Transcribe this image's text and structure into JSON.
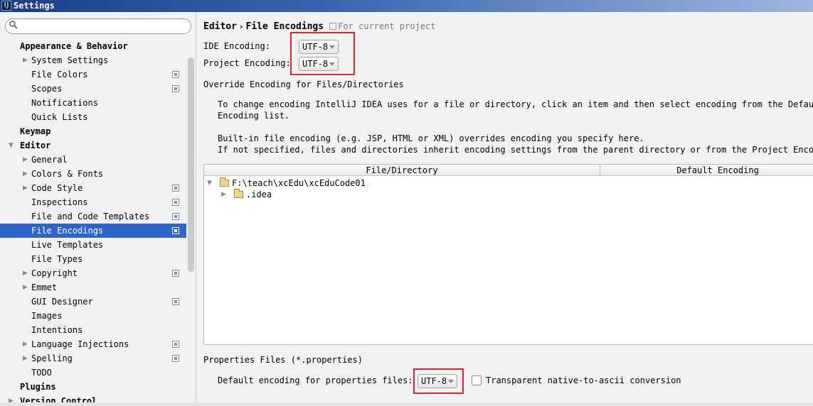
{
  "window": {
    "title": "Settings",
    "icon": "intellij-app-icon"
  },
  "sidebar": {
    "search": {
      "value": "",
      "placeholder": ""
    },
    "items": [
      {
        "label": "Appearance & Behavior",
        "level": 0,
        "bold": true,
        "arrow": ""
      },
      {
        "label": "System Settings",
        "level": 1,
        "arrow": "right"
      },
      {
        "label": "File Colors",
        "level": 1,
        "arrow": "",
        "project_icon": true
      },
      {
        "label": "Scopes",
        "level": 1,
        "arrow": "",
        "project_icon": true
      },
      {
        "label": "Notifications",
        "level": 1,
        "arrow": ""
      },
      {
        "label": "Quick Lists",
        "level": 1,
        "arrow": ""
      },
      {
        "label": "Keymap",
        "level": 0,
        "bold": true,
        "arrow": ""
      },
      {
        "label": "Editor",
        "level": 0,
        "bold": true,
        "arrow": "down"
      },
      {
        "label": "General",
        "level": 1,
        "arrow": "right"
      },
      {
        "label": "Colors & Fonts",
        "level": 1,
        "arrow": "right"
      },
      {
        "label": "Code Style",
        "level": 1,
        "arrow": "right",
        "project_icon": true
      },
      {
        "label": "Inspections",
        "level": 1,
        "arrow": "",
        "project_icon": true
      },
      {
        "label": "File and Code Templates",
        "level": 1,
        "arrow": "",
        "project_icon": true
      },
      {
        "label": "File Encodings",
        "level": 1,
        "arrow": "",
        "project_icon": true,
        "selected": true
      },
      {
        "label": "Live Templates",
        "level": 1,
        "arrow": ""
      },
      {
        "label": "File Types",
        "level": 1,
        "arrow": ""
      },
      {
        "label": "Copyright",
        "level": 1,
        "arrow": "right",
        "project_icon": true
      },
      {
        "label": "Emmet",
        "level": 1,
        "arrow": "right"
      },
      {
        "label": "GUI Designer",
        "level": 1,
        "arrow": "",
        "project_icon": true
      },
      {
        "label": "Images",
        "level": 1,
        "arrow": ""
      },
      {
        "label": "Intentions",
        "level": 1,
        "arrow": ""
      },
      {
        "label": "Language Injections",
        "level": 1,
        "arrow": "right",
        "project_icon": true
      },
      {
        "label": "Spelling",
        "level": 1,
        "arrow": "right",
        "project_icon": true
      },
      {
        "label": "TODO",
        "level": 1,
        "arrow": ""
      },
      {
        "label": "Plugins",
        "level": 0,
        "bold": true,
        "arrow": ""
      },
      {
        "label": "Version Control",
        "level": 0,
        "bold": true,
        "arrow": "right"
      }
    ]
  },
  "content": {
    "breadcrumb": {
      "parent": "Editor",
      "separator": "›",
      "current": "File Encodings",
      "scope": "For current project"
    },
    "ide_encoding": {
      "label": "IDE Encoding:",
      "value": "UTF-8"
    },
    "project_encoding": {
      "label": "Project Encoding:",
      "value": "UTF-8"
    },
    "override_section": {
      "title": "Override Encoding for Files/Directories",
      "line1": "To change encoding IntelliJ IDEA uses for a file or directory, click an item and then select encoding from the Default",
      "line2": "Encoding list.",
      "line3": "Built-in file encoding (e.g. JSP, HTML or XML) overrides encoding you specify here.",
      "line4": "If not specified, files and directories inherit encoding settings from the parent directory or from the Project Encoding"
    },
    "table": {
      "columns": [
        "File/Directory",
        "Default Encoding"
      ],
      "rows": [
        {
          "path": "F:\\teach\\xcEdu\\xcEduCode01",
          "arrow": "down"
        },
        {
          "path": ".idea",
          "arrow": "right"
        }
      ]
    },
    "properties": {
      "title": "Properties Files (*.properties)",
      "label": "Default encoding for properties files:",
      "value": "UTF-8",
      "transparent_label": "Transparent native-to-ascii conversion",
      "transparent_checked": false
    },
    "highlight_color": "#e8232d",
    "selection_color": "#2f65ca"
  }
}
